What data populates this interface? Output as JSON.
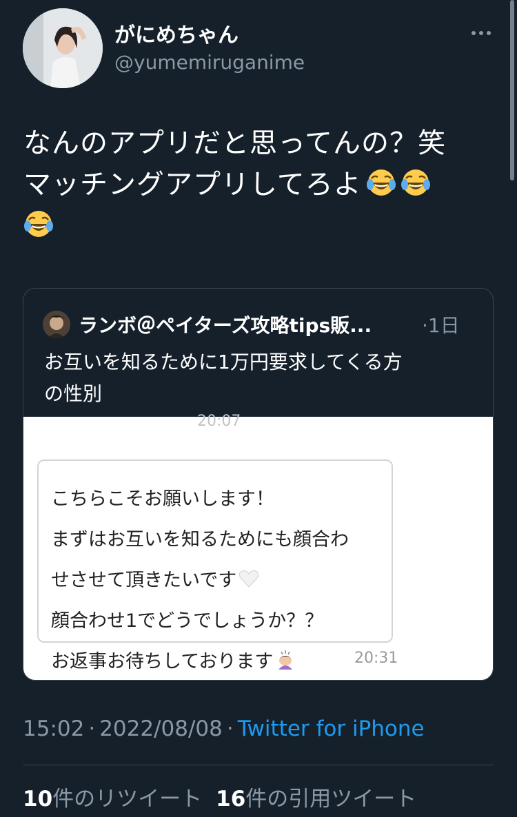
{
  "tweet": {
    "author": {
      "name": "がにめちゃん",
      "handle": "@yumemiruganime"
    },
    "text_lines": [
      "なんのアプリだと思ってんの？笑",
      "マッチングアプリしてろよ"
    ],
    "emoji": "face-with-tears-of-joy",
    "timestamp": "15:02",
    "date": "2022/08/08",
    "separator": "·",
    "client": "Twitter for iPhone"
  },
  "quoted_tweet": {
    "author_name": "ランボ＠ペイターズ攻略tips販...",
    "time_separator": "·",
    "time": "1日",
    "text_lines": [
      "お互いを知るために1万円要求してくる方",
      "の性別"
    ],
    "media": {
      "time_top": "20:07",
      "message_lines": [
        "こちらこそお願いします！",
        "まずはお互いを知るためにも顔合わ",
        "せさせて頂きたいです",
        "顔合わせ1でどうでしょうか？？",
        "お返事お待ちしております"
      ],
      "time_bottom": "20:31",
      "emojis": [
        "white-heart",
        "person-bowing"
      ]
    }
  },
  "stats": {
    "retweets_count": "10",
    "retweets_label": "件のリツイート",
    "quotes_count": "16",
    "quotes_label": "件の引用ツイート"
  },
  "colors": {
    "background": "#15202b",
    "secondary_text": "#8b98a5",
    "link": "#1d9bf0",
    "border": "#38444d"
  }
}
